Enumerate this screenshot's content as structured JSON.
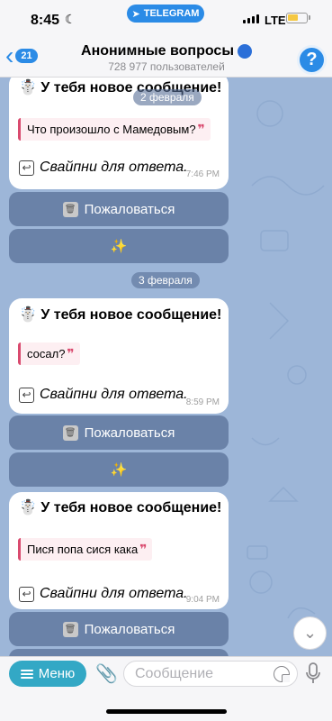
{
  "status_bar": {
    "time": "8:45",
    "app_pill": "TELEGRAM",
    "network": "LTE"
  },
  "header": {
    "back_count": "21",
    "title": "Анонимные вопросы",
    "subtitle": "728 977 пользователей",
    "avatar_glyph": "?"
  },
  "messages": [
    {
      "emoji": "☃️",
      "heading": "У тебя новое сообщение!",
      "question": "Что произошло с Мамедовым?",
      "swipe_hint": "Свайпни для ответа.",
      "time": "7:46 PM",
      "report_label": "Пожаловаться",
      "sparkle": "✨"
    },
    {
      "emoji": "☃️",
      "heading": "У тебя новое сообщение!",
      "question": "сосал?",
      "swipe_hint": "Свайпни для ответа.",
      "time": "8:59 PM",
      "report_label": "Пожаловаться",
      "sparkle": "✨"
    },
    {
      "emoji": "☃️",
      "heading": "У тебя новое сообщение!",
      "question": "Пися попа сися кака",
      "swipe_hint": "Свайпни для ответа.",
      "time": "9:04 PM",
      "report_label": "Пожаловаться"
    }
  ],
  "date_separators": [
    "2 февраля",
    "3 февраля"
  ],
  "quote_mark": "❞",
  "input_bar": {
    "menu_label": "Меню",
    "placeholder": "Сообщение"
  },
  "icons": {
    "back": "chevron-left-icon",
    "scroll_down": "chevron-down-icon",
    "attach": "paperclip-icon",
    "sticker": "sticker-icon",
    "mic": "microphone-icon",
    "report": "trash-icon",
    "swipe": "reply-arrow-icon"
  },
  "colors": {
    "accent": "#2b8be6",
    "menu_button": "#33a8c5",
    "chat_background": "#9db6d8",
    "quote_bar": "#d94a6e"
  }
}
